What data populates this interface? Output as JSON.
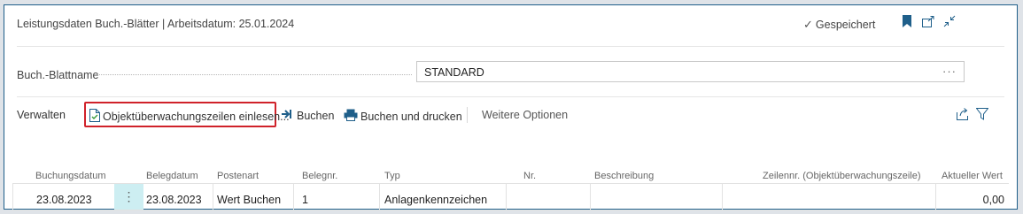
{
  "header": {
    "title": "Leistungsdaten Buch.-Blätter | Arbeitsdatum: 25.01.2024",
    "saved_status": "Gespeichert",
    "icons": [
      "bookmark-icon",
      "open-in-new-window-icon",
      "collapse-icon"
    ],
    "accent": "#1f5f8a"
  },
  "form": {
    "label": "Buch.-Blattname",
    "value": "STANDARD",
    "more": "···"
  },
  "actions": {
    "manage": "Verwalten",
    "import_lines": "Objektüberwachungszeilen einlesen...",
    "post": "Buchen",
    "post_print": "Buchen und drucken",
    "more_options": "Weitere Optionen",
    "highlight_color": "#d0222a"
  },
  "grid": {
    "columns": [
      "Buchungsdatum",
      "Belegdatum",
      "Postenart",
      "Belegnr.",
      "Typ",
      "Nr.",
      "Beschreibung",
      "Zeilennr. (Objektüberwachungszeile)",
      "Aktueller Wert"
    ],
    "row": {
      "posting_date": "23.08.2023",
      "menu": "⋮",
      "document_date": "23.08.2023",
      "entry_type": "Wert Buchen",
      "document_no": "1",
      "type": "Anlagenkennzeichen",
      "no": "",
      "description": "",
      "line_no": "",
      "current_value": "0,00"
    },
    "row_menu_color": "#cdeef2"
  }
}
